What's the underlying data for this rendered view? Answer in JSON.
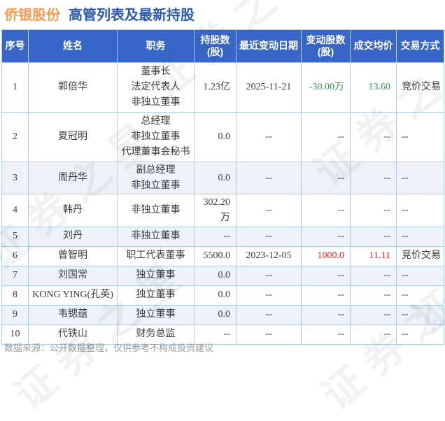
{
  "title": {
    "stock": "侨银股份",
    "subtitle": "高管列表及最新持股"
  },
  "colors": {
    "title_orange": "#fb9b50",
    "title_blue": "#2d5ab4",
    "header_bg": "#3866c8",
    "border": "#aecde8",
    "shaded_row_bg": "#eef2f8",
    "negative_green": "#2ba34f",
    "positive_red": "#ee2222",
    "footer_gray": "#9a9a9a"
  },
  "watermark": {
    "text": "证券之星"
  },
  "table": {
    "headers": [
      "序号",
      "姓名",
      "职务",
      "持股数\n(股)",
      "最近变动日期",
      "变动股数\n(股)",
      "成交均价",
      "交易方式"
    ],
    "rows": [
      {
        "no": "1",
        "name": "郭倍华",
        "position": "董事长\n法定代表人\n非独立董事",
        "shares": "1.23亿",
        "change_date": "2025-11-21",
        "change_shares": "-30.00万",
        "avg_price": "13.60",
        "trade_method": "竞价交易",
        "change_color": "green",
        "price_color": "green"
      },
      {
        "no": "2",
        "name": "夏冠明",
        "position": "总经理\n非独立董事\n代理董事会秘书",
        "shares": "0.0",
        "change_date": "--",
        "change_shares": "--",
        "avg_price": "--",
        "trade_method": "--",
        "change_color": "",
        "price_color": ""
      },
      {
        "no": "3",
        "name": "周丹华",
        "position": "副总经理\n非独立董事",
        "shares": "0.0",
        "change_date": "--",
        "change_shares": "--",
        "avg_price": "--",
        "trade_method": "--",
        "change_color": "",
        "price_color": ""
      },
      {
        "no": "4",
        "name": "韩丹",
        "position": "非独立董事",
        "shares": "302.20万",
        "change_date": "--",
        "change_shares": "--",
        "avg_price": "--",
        "trade_method": "--",
        "change_color": "",
        "price_color": ""
      },
      {
        "no": "5",
        "name": "刘丹",
        "position": "非独立董事",
        "shares": "--",
        "change_date": "--",
        "change_shares": "--",
        "avg_price": "--",
        "trade_method": "--",
        "change_color": "",
        "price_color": ""
      },
      {
        "no": "6",
        "name": "曾智明",
        "position": "职工代表董事",
        "shares": "5500.0",
        "change_date": "2023-12-05",
        "change_shares": "1000.0",
        "avg_price": "11.11",
        "trade_method": "竞价交易",
        "change_color": "red",
        "price_color": "red"
      },
      {
        "no": "7",
        "name": "刘国常",
        "position": "独立董事",
        "shares": "0.0",
        "change_date": "--",
        "change_shares": "--",
        "avg_price": "--",
        "trade_method": "--",
        "change_color": "",
        "price_color": ""
      },
      {
        "no": "8",
        "name": "KONG YING(孔英)",
        "position": "独立董事",
        "shares": "0.0",
        "change_date": "--",
        "change_shares": "--",
        "avg_price": "--",
        "trade_method": "--",
        "change_color": "",
        "price_color": ""
      },
      {
        "no": "9",
        "name": "韦锶蕴",
        "position": "独立董事",
        "shares": "0.0",
        "change_date": "--",
        "change_shares": "--",
        "avg_price": "--",
        "trade_method": "--",
        "change_color": "",
        "price_color": ""
      },
      {
        "no": "10",
        "name": "代铁山",
        "position": "财务总监",
        "shares": "--",
        "change_date": "--",
        "change_shares": "--",
        "avg_price": "--",
        "trade_method": "--",
        "change_color": "",
        "price_color": ""
      }
    ]
  },
  "footer": {
    "source": "数据来源：公开数据整理，仅供参考不构成投资建议"
  }
}
